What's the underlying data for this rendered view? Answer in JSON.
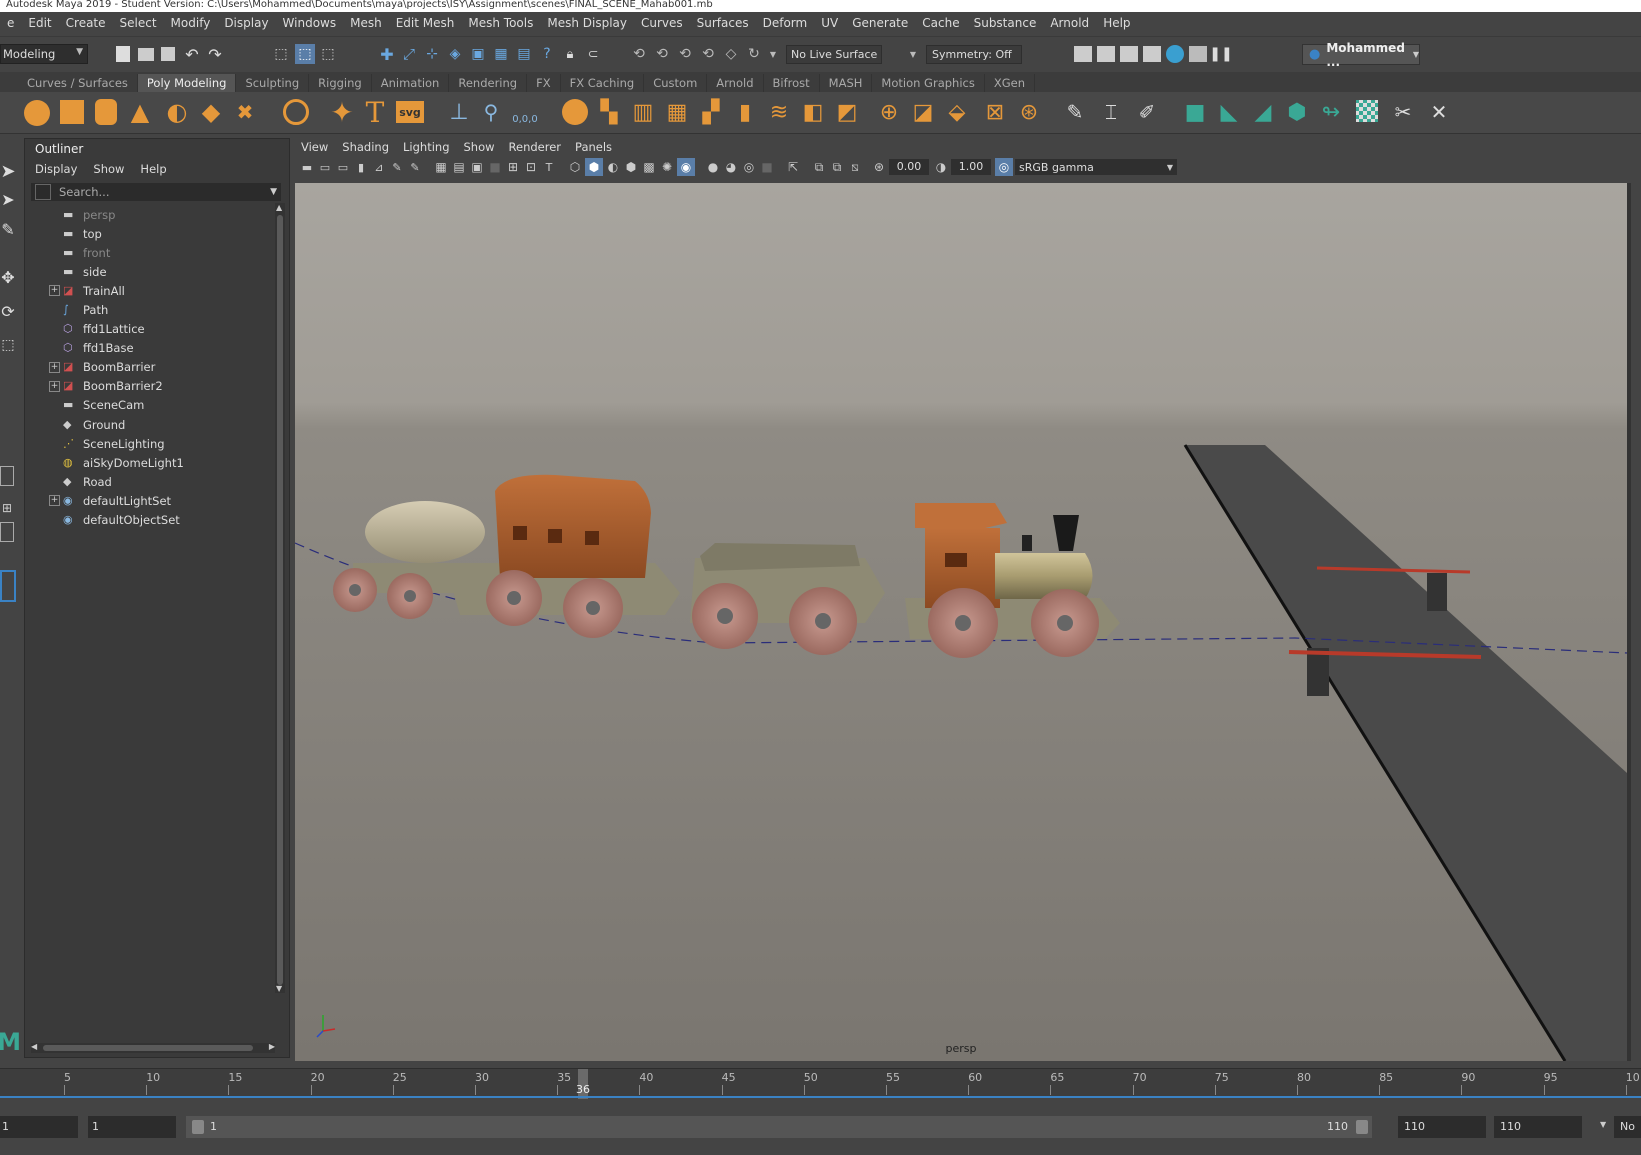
{
  "title_bar": "Autodesk Maya 2019 - Student Version: C:\\Users\\Mohammed\\Documents\\maya\\projects\\ISY\\Assignment\\scenes\\FINAL_SCENE_Mahab001.mb",
  "menu": [
    "e",
    "Edit",
    "Create",
    "Select",
    "Modify",
    "Display",
    "Windows",
    "Mesh",
    "Edit Mesh",
    "Mesh Tools",
    "Mesh Display",
    "Curves",
    "Surfaces",
    "Deform",
    "UV",
    "Generate",
    "Cache",
    "Substance",
    "Arnold",
    "Help"
  ],
  "status_line": {
    "mode": "Modeling",
    "live_surface": "No Live Surface",
    "symmetry": "Symmetry: Off",
    "user": "Mohammed ..."
  },
  "shelf_tabs": [
    {
      "label": "Curves / Surfaces",
      "active": false
    },
    {
      "label": "Poly Modeling",
      "active": true
    },
    {
      "label": "Sculpting",
      "active": false
    },
    {
      "label": "Rigging",
      "active": false
    },
    {
      "label": "Animation",
      "active": false
    },
    {
      "label": "Rendering",
      "active": false
    },
    {
      "label": "FX",
      "active": false
    },
    {
      "label": "FX Caching",
      "active": false
    },
    {
      "label": "Custom",
      "active": false
    },
    {
      "label": "Arnold",
      "active": false
    },
    {
      "label": "Bifrost",
      "active": false
    },
    {
      "label": "MASH",
      "active": false
    },
    {
      "label": "Motion Graphics",
      "active": false
    },
    {
      "label": "XGen",
      "active": false
    }
  ],
  "shelf_icons": {
    "text_icon": "T",
    "svg_icon": "svg",
    "origin_icon": "0,0,0"
  },
  "outliner": {
    "title": "Outliner",
    "menus": [
      "Display",
      "Show",
      "Help"
    ],
    "search_placeholder": "Search...",
    "items": [
      {
        "label": "persp",
        "icon": "camera-icon",
        "dim": true,
        "expandable": false
      },
      {
        "label": "top",
        "icon": "camera-icon",
        "dim": false,
        "expandable": false
      },
      {
        "label": "front",
        "icon": "camera-icon",
        "dim": true,
        "expandable": false
      },
      {
        "label": "side",
        "icon": "camera-icon",
        "dim": false,
        "expandable": false
      },
      {
        "label": "TrainAll",
        "icon": "group-icon",
        "dim": false,
        "expandable": true
      },
      {
        "label": "Path",
        "icon": "curve-icon",
        "dim": false,
        "expandable": false
      },
      {
        "label": "ffd1Lattice",
        "icon": "lattice-icon",
        "dim": false,
        "expandable": false
      },
      {
        "label": "ffd1Base",
        "icon": "lattice-icon",
        "dim": false,
        "expandable": false
      },
      {
        "label": "BoomBarrier",
        "icon": "group-icon",
        "dim": false,
        "expandable": true
      },
      {
        "label": "BoomBarrier2",
        "icon": "group-icon",
        "dim": false,
        "expandable": true
      },
      {
        "label": "SceneCam",
        "icon": "camera-icon",
        "dim": false,
        "expandable": false
      },
      {
        "label": "Ground",
        "icon": "mesh-icon",
        "dim": false,
        "expandable": false
      },
      {
        "label": "SceneLighting",
        "icon": "light-group-icon",
        "dim": false,
        "expandable": false
      },
      {
        "label": "aiSkyDomeLight1",
        "icon": "skydome-icon",
        "dim": false,
        "expandable": false
      },
      {
        "label": "Road",
        "icon": "mesh-icon",
        "dim": false,
        "expandable": false
      },
      {
        "label": "defaultLightSet",
        "icon": "set-icon",
        "dim": false,
        "expandable": true
      },
      {
        "label": "defaultObjectSet",
        "icon": "set-icon",
        "dim": false,
        "expandable": false
      }
    ]
  },
  "viewport": {
    "menus": [
      "View",
      "Shading",
      "Lighting",
      "Show",
      "Renderer",
      "Panels"
    ],
    "exposure": "0.00",
    "gamma": "1.00",
    "color_space": "sRGB gamma",
    "camera_label": "persp"
  },
  "timeline": {
    "ticks": [
      "5",
      "10",
      "15",
      "20",
      "25",
      "30",
      "35",
      "40",
      "45",
      "50",
      "55",
      "60",
      "65",
      "70",
      "75",
      "80",
      "85",
      "90",
      "95",
      "10"
    ],
    "current_frame": "36"
  },
  "range": {
    "start": "1",
    "slider_start": "1",
    "slider_end": "110",
    "end": "110",
    "anim_end": "110",
    "right_label": "No",
    "left_stub": "1"
  },
  "colors": {
    "accent_blue": "#3a82c4",
    "shelf_orange": "#e5983a",
    "shelf_teal": "#3aa895"
  }
}
